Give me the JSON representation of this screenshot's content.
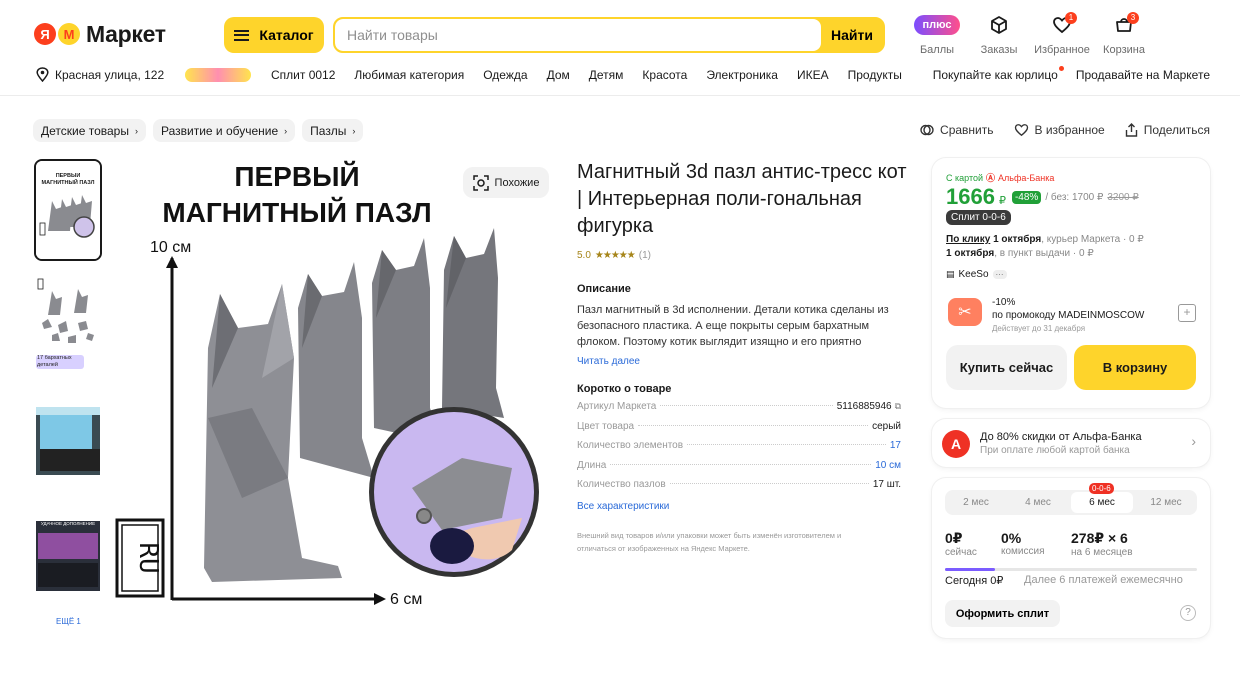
{
  "header": {
    "logo_text": "Маркет",
    "catalog_label": "Каталог",
    "search_placeholder": "Найти товары",
    "search_button": "Найти",
    "plus_label": "плюс",
    "points_label": "Баллы",
    "orders_label": "Заказы",
    "favorites_label": "Избранное",
    "favorites_count": "1",
    "cart_label": "Корзина",
    "cart_count": "3",
    "address": "Красная улица, 122",
    "nav": [
      "Сплит 0012",
      "Любимая категория",
      "Одежда",
      "Дом",
      "Детям",
      "Красота",
      "Электроника",
      "ИКЕА",
      "Продукты"
    ],
    "legal_link": "Покупайте как юрлицо",
    "sell_link": "Продавайте на Маркете"
  },
  "breadcrumbs": [
    "Детские товары",
    "Развитие и обучение",
    "Пазлы"
  ],
  "page_actions": {
    "compare": "Сравнить",
    "favorite": "В избранное",
    "share": "Поделиться"
  },
  "gallery": {
    "thumb1_text": "ПЕРВЫЙ МАГНИТНЫЙ ПАЗЛ",
    "thumb2_badge": "17 бархатных деталей",
    "thumb4_text": "УДАЧНОЕ ДОПОЛНЕНИЕ",
    "more_label": "ЕЩЁ 1",
    "similar_button": "Похожие",
    "main_heading_1": "ПЕРВЫЙ",
    "main_heading_2": "МАГНИТНЫЙ ПАЗЛ",
    "height_label": "10 см",
    "width_label": "6 см",
    "brand_logo": "RU"
  },
  "product": {
    "title": "Магнитный 3d пазл антис-тресс кот | Интерьерная поли-гональная фигурка",
    "rating": "5.0",
    "rating_stars": 5,
    "reviews": "(1)",
    "description_heading": "Описание",
    "description": "Пазл магнитный в 3d исполнении. Детали котика сделаны из безопасного пластика. А еще покрыты серым бархатным флоком. Поэтому котик выглядит изящно и его приятно",
    "read_more": "Читать далее",
    "about_heading": "Коротко о товаре",
    "specs": [
      {
        "key": "Артикул Маркета",
        "value": "5116885946",
        "link": false
      },
      {
        "key": "Цвет товара",
        "value": "серый",
        "link": false
      },
      {
        "key": "Количество элементов",
        "value": "17",
        "link": true
      },
      {
        "key": "Длина",
        "value": "10 см",
        "link": true
      },
      {
        "key": "Количество пазлов",
        "value": "17 шт.",
        "link": false
      }
    ],
    "all_specs": "Все характеристики",
    "disclaimer": "Внешний вид товаров и/или упаковки может быть изменён изготовителем и отличаться от изображенных на Яндекс Маркете."
  },
  "buy_card": {
    "card_label": "С картой",
    "bank_name": "Альфа-Банка",
    "price": "1666",
    "currency": "₽",
    "discount": "-48%",
    "without_card": "/ без: 1700 ₽",
    "old_price": "3200 ₽",
    "split_badge": "Сплит 0-0-6",
    "delivery_click": "По клику",
    "delivery_click_date": "1 октября",
    "delivery_click_rest": ", курьер Маркета · 0 ₽",
    "delivery_pickup_date": "1 октября",
    "delivery_pickup_rest": ", в пункт выдачи · 0 ₽",
    "seller": "KeeSo",
    "promo_pct": "-10%",
    "promo_text": "по промокоду MADEINMOSCOW",
    "promo_valid": "Действует до 31 декабря",
    "buy_now": "Купить сейчас",
    "to_cart": "В корзину"
  },
  "bank_offer": {
    "title": "До 80% скидки от Альфа-Банка",
    "subtitle": "При оплате любой картой банка"
  },
  "split": {
    "tabs": [
      "2 мес",
      "4 мес",
      "6 мес",
      "12 мес"
    ],
    "active_tab": 2,
    "tab_badge": "0-0-6",
    "now_value": "0₽",
    "now_label": "сейчас",
    "fee_value": "0%",
    "fee_label": "комиссия",
    "monthly_value": "278₽ × 6",
    "monthly_label": "на 6 месяцев",
    "today": "Сегодня 0₽",
    "later": "Далее 6 платежей ежемесячно",
    "progress": 0.2,
    "button": "Оформить сплит",
    "help": "?"
  },
  "colors": {
    "brand_yellow": "#fed42b",
    "brand_red": "#fc3f1d",
    "price_green": "#21a038",
    "link_blue": "#2a6ad8"
  }
}
